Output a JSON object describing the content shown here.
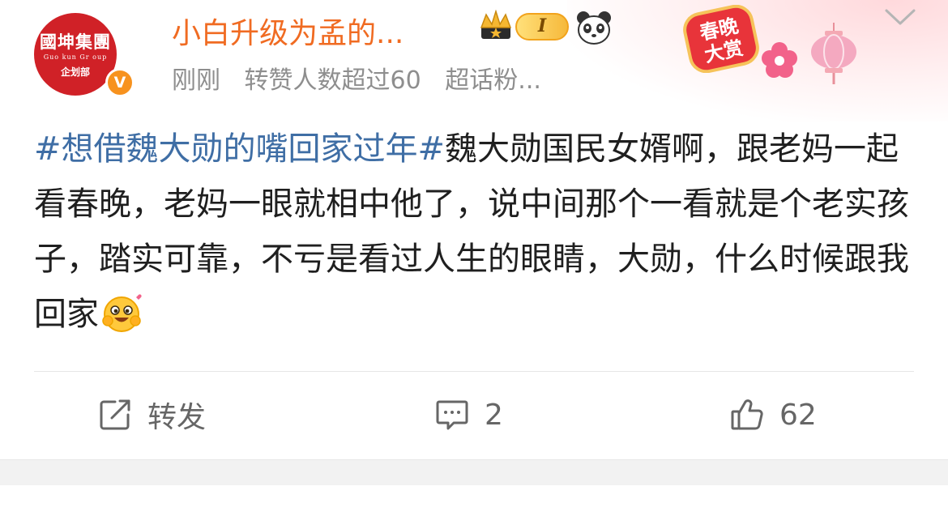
{
  "post": {
    "avatar": {
      "title": "國坤集團",
      "subtitle": "Guo kun Gr oup",
      "dept": "企划部",
      "verify_mark": "V"
    },
    "username": "小白升级为孟的...",
    "level_badge": "I",
    "meta": {
      "time": "刚刚",
      "repost_info": "转赞人数超过60",
      "fan_label": "超话粉..."
    },
    "festival_badge": {
      "line1": "春晚",
      "line2": "大赏"
    },
    "text": {
      "topic": "#想借魏大勋的嘴回家过年#",
      "body": "魏大勋国民女婿啊，跟老妈一起看春晚，老妈一眼就相中他了，说中间那个一看就是个老实孩子，踏实可靠，不亏是看过人生的眼睛，大勋，什么时候跟我回家"
    },
    "actions": {
      "repost_label": "转发",
      "comment_count": "2",
      "like_count": "62"
    }
  },
  "colors": {
    "username": "#f06b22",
    "topic": "#3f6ea5",
    "meta": "#8e8e8e",
    "avatar_red": "#d02127",
    "verify_orange": "#f7921e"
  },
  "icons": [
    "crown-icon",
    "level-badge",
    "panda-icon",
    "festival-badge",
    "lantern-icon",
    "flower-icon",
    "chevron-down-icon",
    "emoji-icon",
    "repost-icon",
    "comment-icon",
    "like-icon"
  ]
}
